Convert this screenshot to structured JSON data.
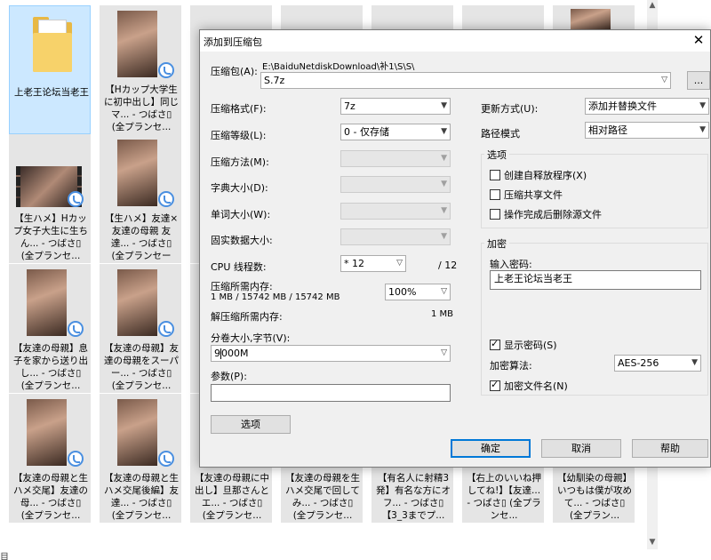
{
  "explorer": {
    "folder_label": "上老王论坛当老王",
    "tiles": [
      "【Hカップ大学生に初中出し】同じマ... - つばさ▯ (全プランセ...",
      "【生ハメ】Hカップ女子大生に生ちん... - つばさ▯ (全プランセ...",
      "【生ハメ】友達×友達の母親 友達... - つばさ▯ (全プランセール...",
      "【友達の母親】息子を家から送り出し... - つばさ▯ (全プランセ...",
      "【友達の母親】友達の母親をスーパー... - つばさ▯ (全プランセ...",
      "【友達の母親と生ハメ交尾】友達の母... - つばさ▯ (全プランセ...",
      "【友達の母親と生ハメ交尾後編】友達... - つばさ▯ (全プランセ...",
      "【友達の母親に中出し】旦那さんとエ... - つばさ▯ (全プランセ...",
      "【友達の母親を生ハメ交尾で回してみ... - つばさ▯ (全プランセ...",
      "【有名人に射精3発】有名な方にオフ... - つばさ▯ 【3_3までプ...",
      "【右上のいいね押してね!】【友達... - つばさ▯ (全プランセ...",
      "【幼馴染の母親】いつもは僕が攻めて... - つばさ▯ (全プラン..."
    ],
    "status_fragment": "目",
    "scroll_up": "▲",
    "scroll_down": "▼"
  },
  "dialog": {
    "title": "添加到压缩包",
    "close": "✕",
    "archive_label": "压缩包(A):",
    "archive_path": "E:\\BaiduNetdiskDownload\\补1\\S\\S\\",
    "archive_name": "S.7z",
    "browse_label": "...",
    "format_label": "压缩格式(F):",
    "format_value": "7z",
    "level_label": "压缩等级(L):",
    "level_value": "0 - 仅存储",
    "method_label": "压缩方法(M):",
    "dict_label": "字典大小(D):",
    "word_label": "单词大小(W):",
    "solid_label": "固实数据大小:",
    "threads_label": "CPU 线程数:",
    "threads_value": "* 12",
    "threads_max": "/ 12",
    "mem_compress_label": "压缩所需内存:",
    "mem_compress_value": "1 MB / 15742 MB / 15742 MB",
    "mem_percent": "100%",
    "mem_decompress_label": "解压缩所需内存:",
    "mem_decompress_value": "1 MB",
    "split_label": "分卷大小,字节(V):",
    "split_value_a": "9",
    "split_value_b": "000M",
    "params_label": "参数(P):",
    "params_value": "",
    "options_button": "选项",
    "update_label": "更新方式(U):",
    "update_value": "添加并替换文件",
    "path_label": "路径模式",
    "path_value": "相对路径",
    "options_group": "选项",
    "opt_sfx": "创建自释放程序(X)",
    "opt_shared": "压缩共享文件",
    "opt_delete": "操作完成后删除源文件",
    "enc_group": "加密",
    "password_label": "输入密码:",
    "password_value": "上老王论坛当老王",
    "show_password": "显示密码(S)",
    "enc_method_label": "加密算法:",
    "enc_method_value": "AES-256",
    "enc_names": "加密文件名(N)",
    "ok": "确定",
    "cancel": "取消",
    "help": "帮助"
  }
}
